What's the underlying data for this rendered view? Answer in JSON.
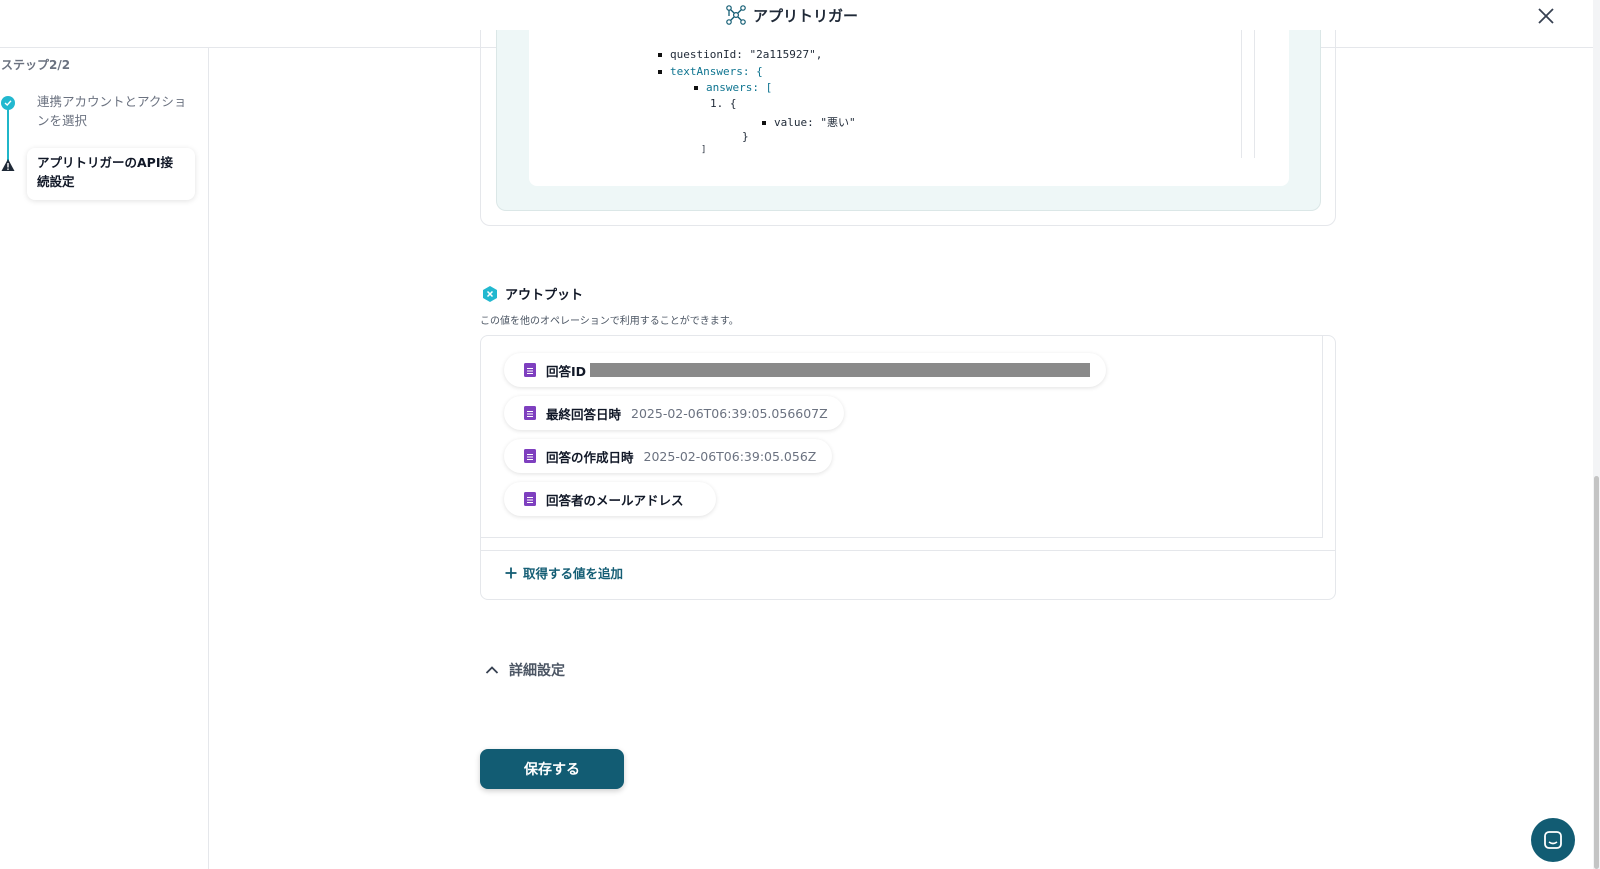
{
  "header": {
    "app_title": "アプリトリガー",
    "logo_icon": "network-nodes-icon",
    "close_icon": "close-icon"
  },
  "sidebar": {
    "step_heading": "ステップ2/2",
    "steps": [
      {
        "label": "連携アカウントとアクションを選択",
        "status": "complete"
      },
      {
        "label": "アプリトリガーのAPI接続設定",
        "status": "warning"
      }
    ]
  },
  "code_preview": {
    "lines": [
      {
        "text": "questionId: \"2a115927\",",
        "key": "questionId"
      },
      {
        "text": "textAnswers: {",
        "key": "textAnswers"
      },
      {
        "text": "answers: [",
        "key": "answers"
      },
      {
        "text": "1. {"
      },
      {
        "text": "value: \"悪い\""
      },
      {
        "text": "}"
      },
      {
        "text": "]"
      }
    ]
  },
  "output": {
    "heading": "アウトプット",
    "description": "この値を他のオペレーションで利用することができます。",
    "items": [
      {
        "label": "回答ID",
        "value": "",
        "redacted": true
      },
      {
        "label": "最終回答日時",
        "value": "2025-02-06T06:39:05.056607Z"
      },
      {
        "label": "回答の作成日時",
        "value": "2025-02-06T06:39:05.056Z"
      },
      {
        "label": "回答者のメールアドレス",
        "value": ""
      }
    ],
    "add_value_label": "取得する値を追加"
  },
  "details": {
    "label": "詳細設定"
  },
  "actions": {
    "save_label": "保存する"
  },
  "colors": {
    "primary": "#125c73",
    "accent": "#22b8cf",
    "doc_icon": "#7e3fbf"
  }
}
